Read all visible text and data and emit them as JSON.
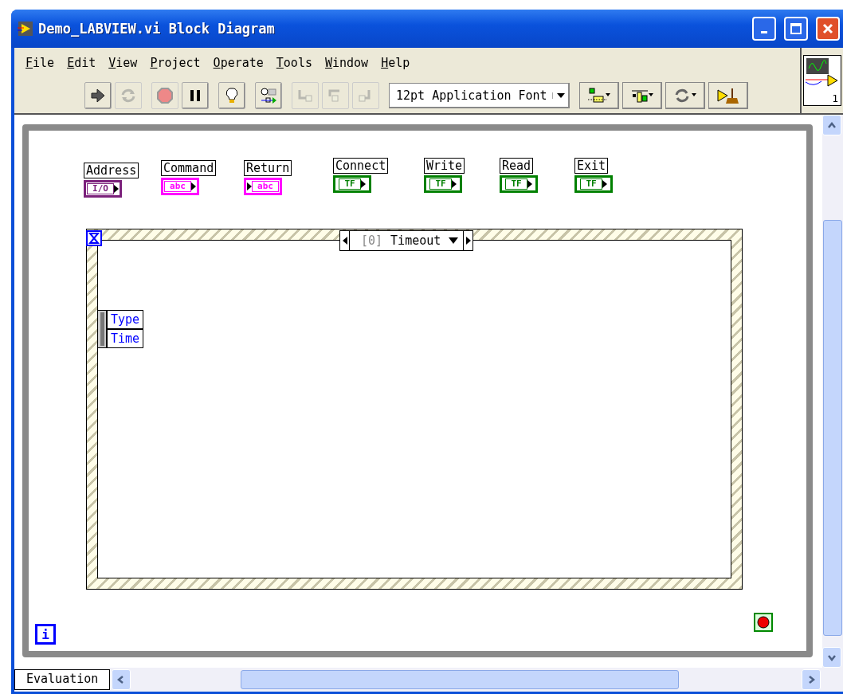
{
  "window": {
    "title": "Demo_LABVIEW.vi Block Diagram"
  },
  "menu": [
    "File",
    "Edit",
    "View",
    "Project",
    "Operate",
    "Tools",
    "Window",
    "Help"
  ],
  "toolbar": {
    "buttons": [
      {
        "kind": "run",
        "disabled": false
      },
      {
        "kind": "run-continuously",
        "disabled": true
      },
      {
        "kind": "abort",
        "disabled": true
      },
      {
        "kind": "pause",
        "disabled": false
      },
      {
        "kind": "highlight",
        "disabled": false
      },
      {
        "kind": "retain",
        "disabled": false
      },
      {
        "kind": "step-into",
        "disabled": true
      },
      {
        "kind": "step-over",
        "disabled": true
      },
      {
        "kind": "step-out",
        "disabled": true
      }
    ],
    "font": "12pt Application Font",
    "tools": [
      {
        "kind": "align"
      },
      {
        "kind": "distribute"
      },
      {
        "kind": "reorder"
      },
      {
        "kind": "cleanup"
      }
    ]
  },
  "connector_pane": {
    "number": "1"
  },
  "terminals": [
    {
      "label": "Address",
      "kind": "io",
      "glyph": "I/O",
      "indicator": false
    },
    {
      "label": "Command",
      "kind": "string",
      "glyph": "abc",
      "indicator": false
    },
    {
      "label": "Return",
      "kind": "string",
      "glyph": "abc",
      "indicator": true
    },
    {
      "label": "Connect",
      "kind": "bool",
      "glyph": "TF",
      "indicator": false
    },
    {
      "label": "Write",
      "kind": "bool",
      "glyph": "TF",
      "indicator": false
    },
    {
      "label": "Read",
      "kind": "bool",
      "glyph": "TF",
      "indicator": false
    },
    {
      "label": "Exit",
      "kind": "bool",
      "glyph": "TF",
      "indicator": false
    }
  ],
  "event_structure": {
    "selector_index": "[0]",
    "selector_label": "Timeout",
    "event_data": [
      "Type",
      "Time"
    ]
  },
  "while_loop": {
    "iteration": "i"
  },
  "status_bar": {
    "tab": "Evaluation"
  }
}
